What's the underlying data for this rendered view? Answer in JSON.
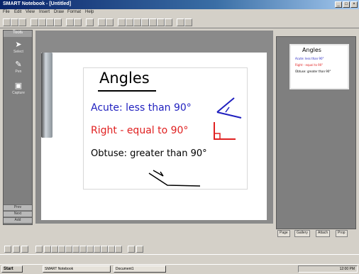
{
  "window": {
    "title": "SMART Notebook - [Untitled]",
    "controls": [
      "_",
      "□",
      "×"
    ]
  },
  "menu": [
    "File",
    "Edit",
    "View",
    "Insert",
    "Draw",
    "Format",
    "Help"
  ],
  "left_panel": {
    "header": "Tools",
    "tools": [
      {
        "icon": "cursor-icon",
        "glyph": "➤",
        "label": "Select"
      },
      {
        "icon": "pen-icon",
        "glyph": "✎",
        "label": "Pen"
      },
      {
        "icon": "screen-capture-icon",
        "glyph": "▣",
        "label": "Capture"
      }
    ],
    "footer_items": [
      "Prev",
      "Next",
      "Add"
    ]
  },
  "board": {
    "title": "Angles",
    "line1": "Acute: less than 90°",
    "line2": "Right - equal to 90°",
    "line3": "Obtuse: greater than 90°"
  },
  "colors": {
    "title_ink": "#000000",
    "acute_ink": "#1f1fbf",
    "right_ink": "#e02020",
    "obtuse_ink": "#000000"
  },
  "right_panel": {
    "thumbnail": {
      "title": "Angles",
      "line1": "Acute: less than 90°",
      "line2": "Right - equal to 90°",
      "line3": "Obtuse: greater than 90°"
    },
    "tabs": [
      "Page",
      "Gallery",
      "Attach",
      "Prop"
    ]
  },
  "taskbar": {
    "start": "Start",
    "items": [
      "SMART Notebook",
      "Document1"
    ],
    "clock": "12:00 PM"
  }
}
